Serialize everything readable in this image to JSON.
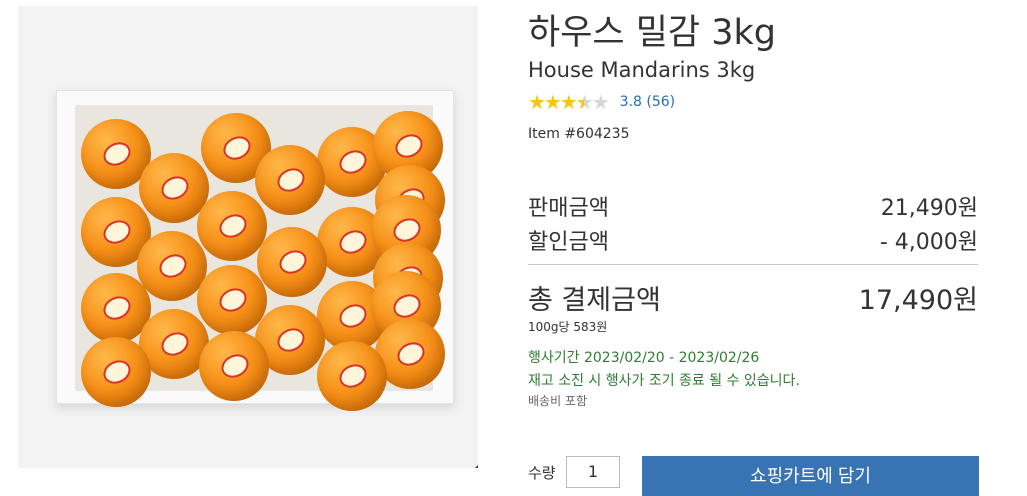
{
  "product": {
    "title_kr": "하우스 밀감 3kg",
    "title_en": "House Mandarins 3kg",
    "rating_value": 3.8,
    "rating_text": "3.8 (56)",
    "item_number": "Item #604235"
  },
  "pricing": {
    "sale_label": "판매금액",
    "sale_value": "21,490원",
    "discount_label": "할인금액",
    "discount_value": "- 4,000원",
    "total_label": "총 결제금액",
    "total_value": "17,490원",
    "unit_price": "100g당 583원"
  },
  "promo": {
    "period": "행사기간 2023/02/20 - 2023/02/26",
    "notice": "재고 소진 시 행사가 조기 종료 될 수 있습니다.",
    "shipping": "배송비 포함"
  },
  "purchase": {
    "qty_label": "수량",
    "qty_value": "1",
    "cart_button": "쇼핑카트에 담기"
  },
  "colors": {
    "accent_blue": "#3873b4",
    "promo_green": "#2f7d32",
    "star_gold": "#f5c518"
  },
  "icons": {
    "zoom": "magnifier-icon",
    "rating": "star-icon"
  }
}
